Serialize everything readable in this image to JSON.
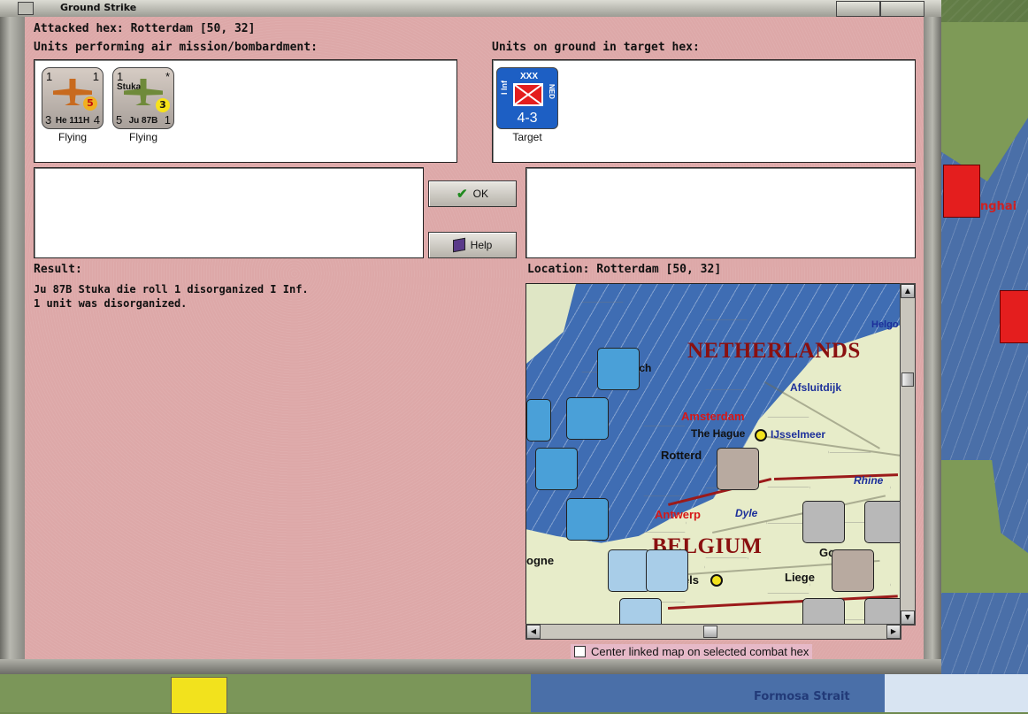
{
  "window": {
    "title": "Ground Strike"
  },
  "attacked_hex": "Attacked hex: Rotterdam  [50, 32]",
  "air_units_label": "Units performing air mission/bombardment:",
  "ground_units_label": "Units on ground in target hex:",
  "air_units": [
    {
      "name": "He 111H",
      "status": "Flying",
      "top_left": "1",
      "top_right": "1",
      "bottom_left": "3",
      "bottom_right": "4",
      "strength": "5",
      "color": "#b8aaa0"
    },
    {
      "name": "Ju 87B",
      "subname": "Stuka",
      "status": "Flying",
      "top_left": "1",
      "top_right": "*",
      "bottom_left": "5",
      "bottom_right": "1",
      "strength": "3",
      "color": "#b8aaa0"
    }
  ],
  "ground_units": [
    {
      "side_label": "I Inf",
      "size": "XXX",
      "nation": "NED",
      "strength": "4-3",
      "status": "Target",
      "color": "#1d5fc4"
    }
  ],
  "buttons": {
    "ok": "OK",
    "help": "Help"
  },
  "result_label": "Result:",
  "result_lines": [
    "Ju 87B Stuka die roll 1 disorganized I Inf.",
    "1 unit was disorganized."
  ],
  "location_label": "Location:  Rotterdam  [50, 32]",
  "map": {
    "countries": [
      "NETHERLANDS",
      "BELGIUM"
    ],
    "cities": {
      "amsterdam": "Amsterdam",
      "the_hague": "The Hague",
      "rotterdam": "Rotterd",
      "antwerp": "Antwerp",
      "brussels": "Brussels",
      "liege": "Liege",
      "ijsselmeer": "IJsselmeer",
      "afsluitdijk": "Afsluitdijk",
      "helgo": "Helgo",
      "rich": "ich",
      "dyle": "Dyle",
      "rhine": "Rhine",
      "logne": "ogne",
      "go": "Go"
    }
  },
  "center_checkbox": "Center linked map on selected combat hex",
  "background": {
    "formosa": "Formosa Strait",
    "nghai": "nghai"
  }
}
